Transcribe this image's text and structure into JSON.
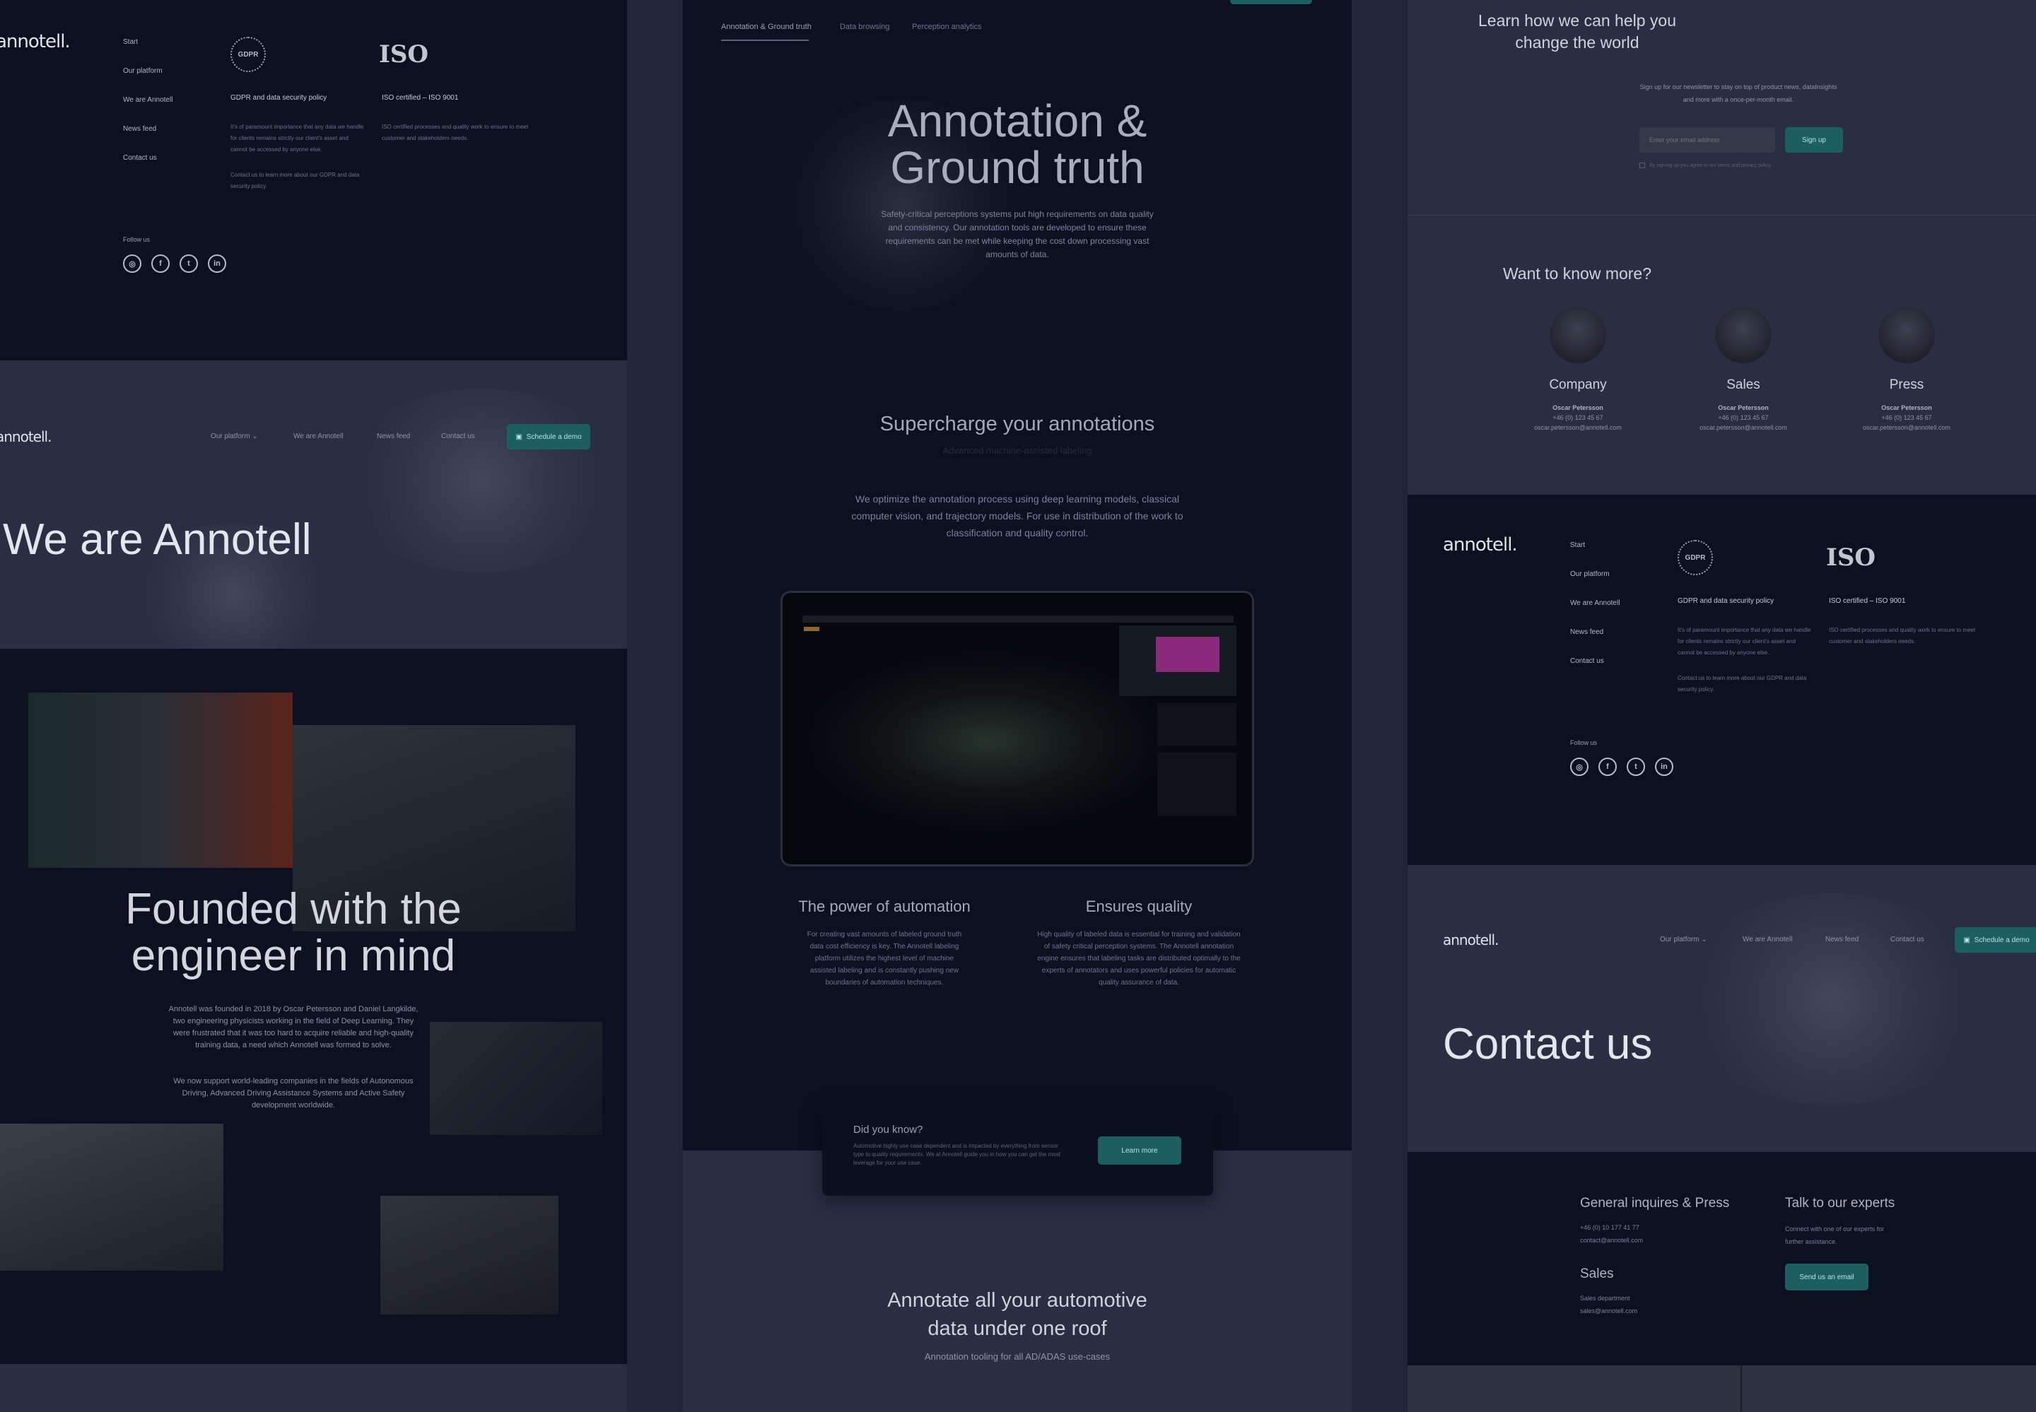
{
  "left_top_footer": {
    "logo": "annotell.",
    "links": [
      "Start",
      "Our platform",
      "We are Annotell",
      "News feed",
      "Contact us"
    ],
    "gdpr_badge": "GDPR",
    "gdpr_title": "GDPR and data security policy",
    "gdpr_text": "It's of paramount importance that any data we handle for clients remains strictly our client's asset and cannot be accessed by anyone else.",
    "gdpr_contact": "Contact us to learn more about our GDPR and data security policy.",
    "iso_badge": "ISO",
    "iso_title": "ISO certified – ISO 9001",
    "iso_text": "ISO certified processes and quality work to ensure to meet customer and stakeholders needs.",
    "follow": "Follow us",
    "social_icons": [
      "instagram-icon",
      "facebook-icon",
      "twitter-icon",
      "linkedin-icon"
    ]
  },
  "left_header": {
    "logo": "annotell.",
    "nav": [
      "Our platform",
      "We are Annotell",
      "News feed",
      "Contact us"
    ],
    "cta": "Schedule a demo",
    "title": "We are Annotell"
  },
  "left_story": {
    "heading_1": "Founded with the",
    "heading_2": "engineer in mind",
    "para_1": "Annotell was founded in 2018 by Oscar Petersson and Daniel Langkilde, two engineering physicists working in the field of Deep Learning. They were frustrated that it was too hard to acquire reliable and high-quality training data, a need which Annotell was formed to solve.",
    "para_2": "We now support world-leading companies in the fields of Autonomous Driving, Advanced Driving Assistance Systems and Active Safety development worldwide."
  },
  "middle": {
    "tabs": [
      "Annotation & Ground truth",
      "Data browsing",
      "Perception analytics"
    ],
    "title_1": "Annotation &",
    "title_2": "Ground truth",
    "intro": "Safety-critical perceptions systems put high requirements on data quality and consistency. Our annotation tools are developed to ensure these requirements can be met while keeping the cost down processing vast amounts of data.",
    "section_title": "Supercharge your annotations",
    "section_sub": "Advanced machine-assisted labeling",
    "section_text": "We optimize the annotation process using deep learning models, classical computer vision, and trajectory models. For use in distribution of the work to classification and quality control.",
    "feature_1_title": "The power of automation",
    "feature_1_text": "For creating vast amounts of labeled ground truth data cost efficiency is key. The Annotell labeling platform utilizes the highest level of machine assisted labeling and is constantly pushing new boundaries of automation techniques.",
    "feature_2_title": "Ensures quality",
    "feature_2_text": "High quality of labeled data is essential for training and validation of safety critical perception systems. The Annotell annotation engine ensures that labeling tasks are distributed optimally to the experts of annotators and uses powerful policies for automatic quality assurance of data.",
    "know_title": "Did you know?",
    "know_text": "Automotive highly use case dependent and is impacted by everything from sensor type to quality requirements. We at Annotell guide you in how you can get the most leverage for your use case.",
    "know_button": "Learn more",
    "bottom_title_1": "Annotate all your automotive",
    "bottom_title_2": "data under one roof",
    "bottom_sub": "Annotation tooling for all AD/ADAS use-cases"
  },
  "right_newsletter": {
    "title_1": "Learn how we can help you",
    "title_2": "change the world",
    "text": "Sign up for our newsletter to stay on top of product news, dataInsights and more with a once-per-month email.",
    "placeholder": "Enter your email address",
    "button": "Sign up",
    "consent": "By signing up you agree to our terms and privacy policy."
  },
  "right_contacts": {
    "title": "Want to know more?",
    "people": [
      {
        "role": "Company",
        "name": "Oscar Petersson",
        "phone": "+46 (0) 123 45 67",
        "email": "oscar.petersson@annotell.com"
      },
      {
        "role": "Sales",
        "name": "Oscar Petersson",
        "phone": "+46 (0) 123 45 67",
        "email": "oscar.petersson@annotell.com"
      },
      {
        "role": "Press",
        "name": "Oscar Petersson",
        "phone": "+46 (0) 123 45 67",
        "email": "oscar.petersson@annotell.com"
      }
    ]
  },
  "right_footer": {
    "logo": "annotell.",
    "links": [
      "Start",
      "Our platform",
      "We are Annotell",
      "News feed",
      "Contact us"
    ],
    "gdpr_badge": "GDPR",
    "gdpr_title": "GDPR and data security policy",
    "gdpr_text": "It's of paramount importance that any data we handle for clients remains strictly our client's asset and cannot be accessed by anyone else.",
    "gdpr_contact": "Contact us to learn more about our GDPR and data security policy.",
    "iso_badge": "ISO",
    "iso_title": "ISO certified – ISO 9001",
    "iso_text": "ISO certified processes and quality work to ensure to meet customer and stakeholders needs.",
    "follow": "Follow us"
  },
  "right_header": {
    "logo": "annotell.",
    "nav": [
      "Our platform",
      "We are Annotell",
      "News feed",
      "Contact us"
    ],
    "cta": "Schedule a demo",
    "title": "Contact us"
  },
  "right_contact": {
    "general_title": "General inquires & Press",
    "general_phone": "+46 (0) 10 177 41 77",
    "general_email": "contact@annotell.com",
    "sales_title": "Sales",
    "sales_dept": "Sales department",
    "sales_email": "sales@annotell.com",
    "experts_title": "Talk to our experts",
    "experts_text": "Connect with one of our experts for further assistance.",
    "experts_button": "Send us an email"
  }
}
